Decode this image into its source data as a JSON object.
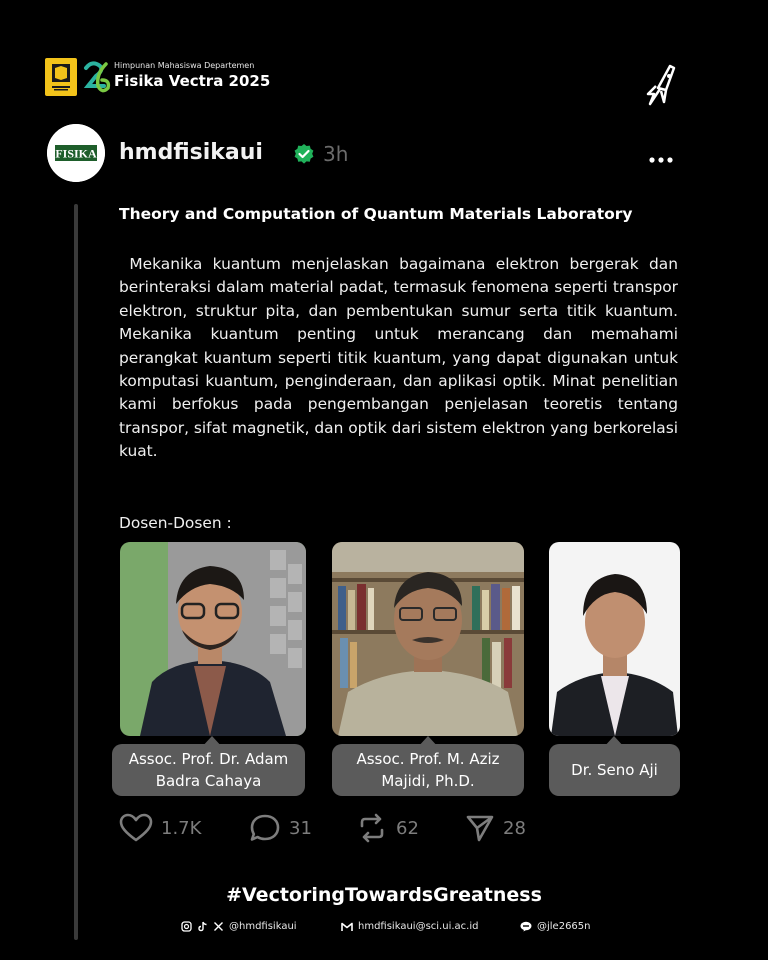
{
  "brand": {
    "subtitle": "Himpunan Mahasiswa Departemen",
    "title": "Fisika Vectra 2025"
  },
  "post": {
    "avatar_text": "FISIKA",
    "username": "hmdfisikaui",
    "time": "3h",
    "title": "Theory and Computation of Quantum Materials Laboratory",
    "body": " Mekanika kuantum menjelaskan bagaimana elektron bergerak dan berinteraksi dalam material padat, termasuk fenomena seperti transpor elektron, struktur pita, dan pembentukan sumur serta titik kuantum. Mekanika kuantum penting untuk merancang dan memahami perangkat kuantum seperti titik kuantum, yang dapat digunakan untuk komputasi kuantum, penginderaan, dan aplikasi optik. Minat penelitian kami berfokus pada pengembangan penjelasan teoretis tentang transpor, sifat magnetik, dan optik dari sistem elektron yang berkorelasi kuat.",
    "dosen_label": "Dosen-Dosen :"
  },
  "lecturers": [
    {
      "name": "Assoc. Prof. Dr. Adam\nBadra Cahaya"
    },
    {
      "name": "Assoc. Prof. M. Aziz\nMajidi, Ph.D."
    },
    {
      "name": "Dr. Seno Aji"
    }
  ],
  "actions": {
    "likes": "1.7K",
    "replies": "31",
    "reposts": "62",
    "shares": "28"
  },
  "footer": {
    "hashtag": "#VectoringTowardsGreatness",
    "social_handle": "@hmdfisikaui",
    "email": "hmdfisikaui@sci.ui.ac.id",
    "line_id": "@jle2665n"
  },
  "colors": {
    "background": "#000000",
    "bubble": "#5b5b5b",
    "verified": "#20b15a",
    "muted": "#7d7d7d",
    "brand_yellow": "#f2c31a"
  }
}
